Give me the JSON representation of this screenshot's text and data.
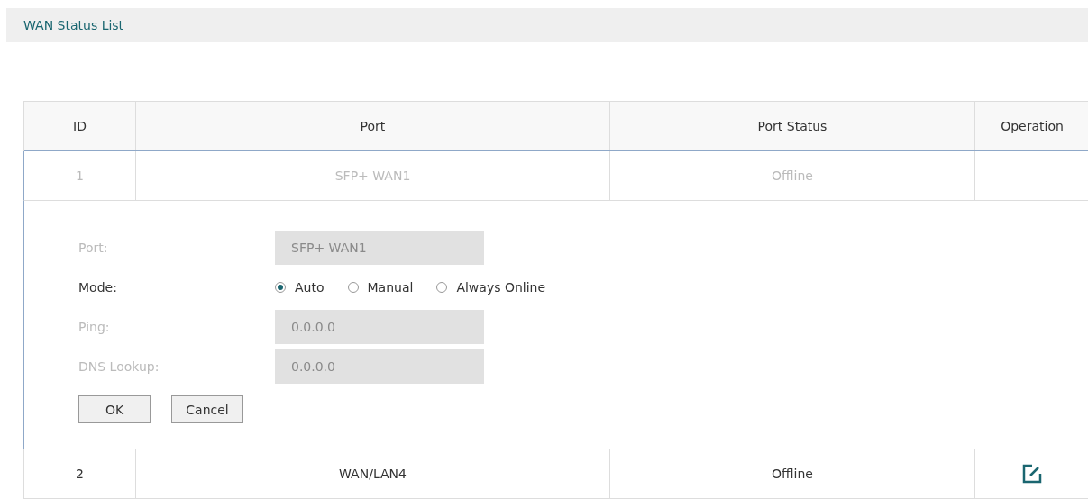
{
  "section": {
    "title": "WAN Status List"
  },
  "table": {
    "columns": [
      "ID",
      "Port",
      "Port Status",
      "Operation"
    ],
    "rows": [
      {
        "id": "1",
        "port": "SFP+ WAN1",
        "status": "Offline",
        "editing": true,
        "editable": false,
        "form": {
          "fields": [
            {
              "kind": "text",
              "label": "Port:",
              "value": "SFP+ WAN1",
              "disabled": true
            },
            {
              "kind": "radio",
              "label": "Mode:",
              "disabled": false,
              "options": [
                {
                  "label": "Auto",
                  "selected": true
                },
                {
                  "label": "Manual",
                  "selected": false
                },
                {
                  "label": "Always Online",
                  "selected": false
                }
              ]
            },
            {
              "kind": "text",
              "label": "Ping:",
              "value": "0.0.0.0",
              "disabled": true
            },
            {
              "kind": "text",
              "label": "DNS Lookup:",
              "value": "0.0.0.0",
              "disabled": true
            }
          ],
          "buttons": [
            "OK",
            "Cancel"
          ]
        }
      },
      {
        "id": "2",
        "port": "WAN/LAN4",
        "status": "Offline",
        "editing": false,
        "editable": true
      }
    ]
  }
}
